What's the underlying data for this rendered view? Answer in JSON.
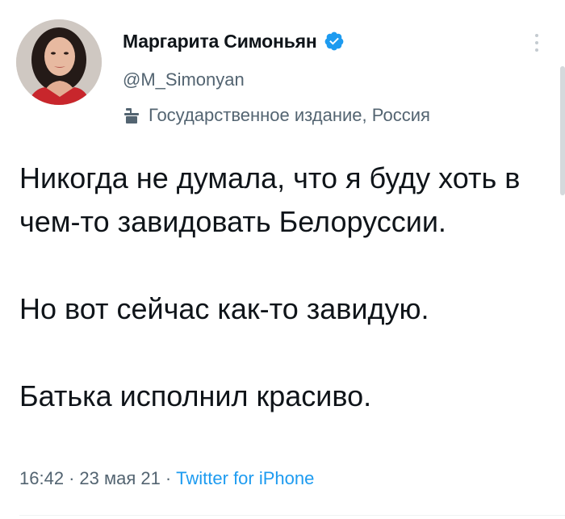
{
  "author": {
    "display_name": "Маргарита Симоньян",
    "handle": "@M_Simonyan",
    "verified": true,
    "state_label": "Государственное издание, Россия",
    "state_icon": "podium-icon"
  },
  "tweet": {
    "paragraphs": [
      "Никогда не думала, что я буду хоть в чем-то завидовать Белоруссии.",
      "Но вот сейчас как-то завидую.",
      "Батька исполнил красиво."
    ],
    "time": "16:42",
    "date": "23 мая 21",
    "separator": "·",
    "source": "Twitter for iPhone"
  },
  "icons": {
    "verified": "verified-badge-icon",
    "more": "more-vertical-icon"
  },
  "colors": {
    "accent": "#1d9bf0",
    "secondary_text": "#536471",
    "primary_text": "#0f1419"
  }
}
